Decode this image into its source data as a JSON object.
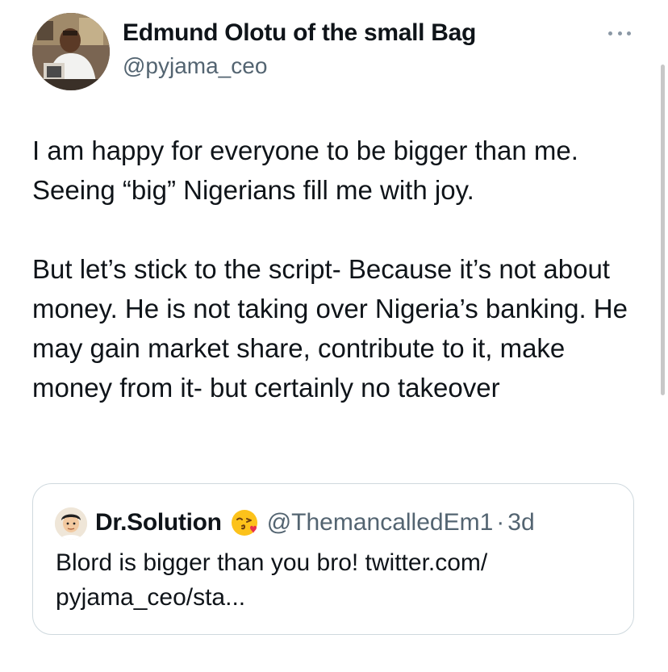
{
  "tweet": {
    "author_name": "Edmund Olotu of the small Bag",
    "author_handle": "@pyjama_ceo",
    "avatar_icon": "profile-photo",
    "more_icon": "more-horizontal-icon",
    "paragraph_1": "I am happy for everyone to be bigger than me. Seeing “big” Nigerians fill me with joy.",
    "paragraph_2": "But let’s stick to the script- Because it’s not about money. He is not taking over Nigeria’s banking. He may gain market share, contribute to it, make money from it- but certainly no takeover"
  },
  "quote": {
    "author_name": "Dr.Solution",
    "emoji": "kiss-face-emoji",
    "author_handle": "@ThemancalledEm1",
    "separator": "·",
    "timestamp": "3d",
    "text": "Blord is bigger than you bro! twitter.com/ pyjama_ceo/sta..."
  },
  "colors": {
    "text_primary": "#0f1419",
    "text_secondary": "#536471",
    "border": "#cfd9de",
    "background": "#ffffff"
  }
}
